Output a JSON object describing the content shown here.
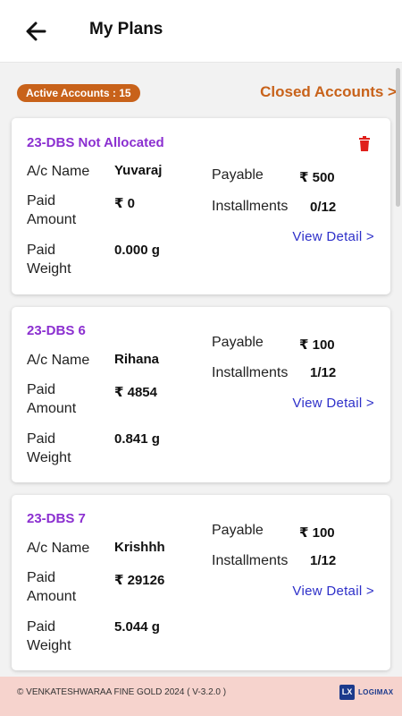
{
  "header": {
    "title": "My Plans"
  },
  "active_badge": "Active Accounts : 15",
  "closed_link": "Closed Accounts >",
  "labels": {
    "ac_name": "A/c Name",
    "paid_amount": "Paid\nAmount",
    "paid_weight": "Paid\nWeight",
    "payable": "Payable",
    "installments": "Installments",
    "view_detail": "View Detail >"
  },
  "plans": [
    {
      "title": "23-DBS Not Allocated",
      "ac_name": "Yuvaraj",
      "paid_amount": "₹ 0",
      "paid_weight": "0.000 g",
      "payable": "₹ 500",
      "installments": "0/12",
      "deletable": true
    },
    {
      "title": "23-DBS 6",
      "ac_name": "Rihana",
      "paid_amount": "₹ 4854",
      "paid_weight": "0.841 g",
      "payable": "₹ 100",
      "installments": "1/12",
      "deletable": false
    },
    {
      "title": "23-DBS 7",
      "ac_name": "Krishhh",
      "paid_amount": "₹ 29126",
      "paid_weight": "5.044 g",
      "payable": "₹ 100",
      "installments": "1/12",
      "deletable": false
    }
  ],
  "footer": {
    "copyright": "© VENKATESHWARAA FINE GOLD 2024 ( V-3.2.0 )",
    "logo_text": "LOGIMAX",
    "logo_mark": "LX"
  },
  "colors": {
    "accent": "#c8621a",
    "title": "#8b2fd0",
    "link": "#2d2fc9",
    "delete": "#e0201b",
    "footer_bg": "#f6d3cd"
  }
}
